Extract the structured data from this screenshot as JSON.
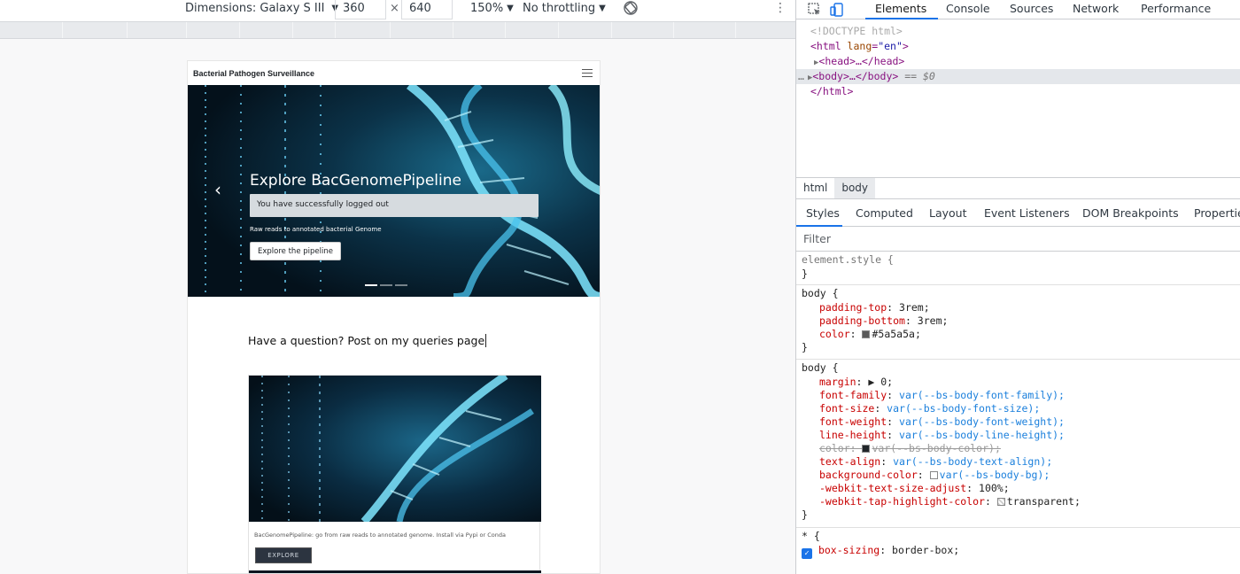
{
  "device_toolbar": {
    "device_label": "Dimensions: Galaxy S III",
    "width_value": "360",
    "times_sign": "×",
    "height_value": "640",
    "zoom_label": "150%",
    "throttling_label": "No throttling",
    "caret": "▼",
    "more": "⋮"
  },
  "page": {
    "brand": "Bacterial Pathogen Surveillance",
    "carousel": {
      "title": "Explore BacGenomePipeline",
      "alert": "You have successfully logged out",
      "subtitle": "Raw reads to annotated bacterial Genome",
      "button": "Explore the pipeline",
      "prev_arrow": "‹"
    },
    "question": "Have a question? Post on my queries page",
    "card": {
      "text": "BacGenomePipeline: go from raw reads to annotated genome. Install via Pypi or Conda",
      "button": "EXPLORE"
    }
  },
  "devtools": {
    "tabs": [
      "Elements",
      "Console",
      "Sources",
      "Network",
      "Performance"
    ],
    "dom": {
      "doctype": "<!DOCTYPE html>",
      "html_open_tag": "<html ",
      "html_attr": "lang",
      "html_attr_eq": "=",
      "html_attr_val": "\"en\"",
      "html_open_close": ">",
      "head": "<head>…</head>",
      "body": "<body>…</body>",
      "body_marker": "== $0",
      "ellipsis": "…",
      "html_close": "</html>"
    },
    "breadcrumbs": [
      "html",
      "body"
    ],
    "subtabs": [
      "Styles",
      "Computed",
      "Layout",
      "Event Listeners",
      "DOM Breakpoints",
      "Properties"
    ],
    "filter_placeholder": "Filter",
    "styles": {
      "element_style": "element.style {",
      "close": "}",
      "body_selector": "body {",
      "body1": [
        {
          "prop": "padding-top",
          "value": "3rem;"
        },
        {
          "prop": "padding-bottom",
          "value": "3rem;"
        },
        {
          "prop": "color",
          "value": "#5a5a5a;"
        }
      ],
      "body2": [
        {
          "prop": "margin",
          "value": "▶ 0;"
        },
        {
          "prop": "font-family",
          "value": "var(--bs-body-font-family);"
        },
        {
          "prop": "font-size",
          "value": "var(--bs-body-font-size);"
        },
        {
          "prop": "font-weight",
          "value": "var(--bs-body-font-weight);"
        },
        {
          "prop": "line-height",
          "value": "var(--bs-body-line-height);"
        },
        {
          "prop": "color",
          "value": "var(--bs-body-color);"
        },
        {
          "prop": "text-align",
          "value": "var(--bs-body-text-align);"
        },
        {
          "prop": "background-color",
          "value": "var(--bs-body-bg);"
        },
        {
          "prop": "-webkit-text-size-adjust",
          "value": "100%;"
        },
        {
          "prop": "-webkit-tap-highlight-color",
          "value": "transparent;"
        }
      ],
      "star_selector": "* {",
      "star_prop": "box-sizing",
      "star_value": "border-box;"
    }
  },
  "colors": {
    "accent": "#1a73e8",
    "body_color_swatch": "#5a5a5a",
    "body_color_swatch2": "#212529",
    "hero_bg": "#061622"
  }
}
